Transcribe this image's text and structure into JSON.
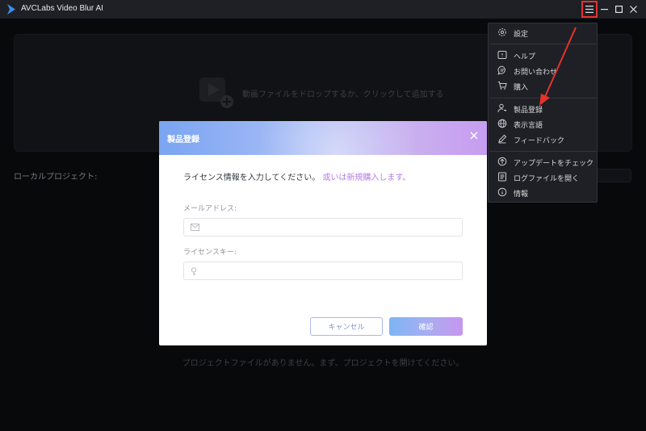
{
  "window": {
    "title": "AVCLabs Video Blur AI",
    "controls": [
      "menu-icon",
      "minimize-icon",
      "maximize-icon",
      "close-icon"
    ]
  },
  "main": {
    "drop_zone_text": "動画ファイルをドロップするか、クリックして追加する",
    "local_projects_label": "ローカルプロジェクト:",
    "empty_projects_text": "プロジェクトファイルがありません。まず、プロジェクトを開けてください。"
  },
  "dialog": {
    "title": "製品登録",
    "prompt": "ライセンス情報を入力してください。",
    "buy_link": "或いは新規購入します。",
    "email_label": "メールアドレス:",
    "email_value": "",
    "email_placeholder": "",
    "license_label": "ライセンスキー:",
    "license_value": "",
    "license_placeholder": "",
    "cancel_label": "キャンセル",
    "confirm_label": "確認"
  },
  "menu": {
    "items": [
      {
        "label": "設定",
        "icon": "gear-icon"
      },
      {
        "label": "ヘルプ",
        "icon": "help-icon"
      },
      {
        "label": "お問い合わせ",
        "icon": "chat-icon"
      },
      {
        "label": "購入",
        "icon": "cart-icon"
      },
      {
        "label": "製品登録",
        "icon": "user-key-icon"
      },
      {
        "label": "表示言語",
        "icon": "globe-icon"
      },
      {
        "label": "フィードバック",
        "icon": "pencil-icon"
      },
      {
        "label": "アップデートをチェック",
        "icon": "update-icon"
      },
      {
        "label": "ログファイルを開く",
        "icon": "log-icon"
      },
      {
        "label": "情報",
        "icon": "info-icon"
      }
    ]
  },
  "colors": {
    "highlight_box": "#e5322d",
    "annotation_arrow": "#e5322d",
    "link_purple": "#b57be8"
  }
}
